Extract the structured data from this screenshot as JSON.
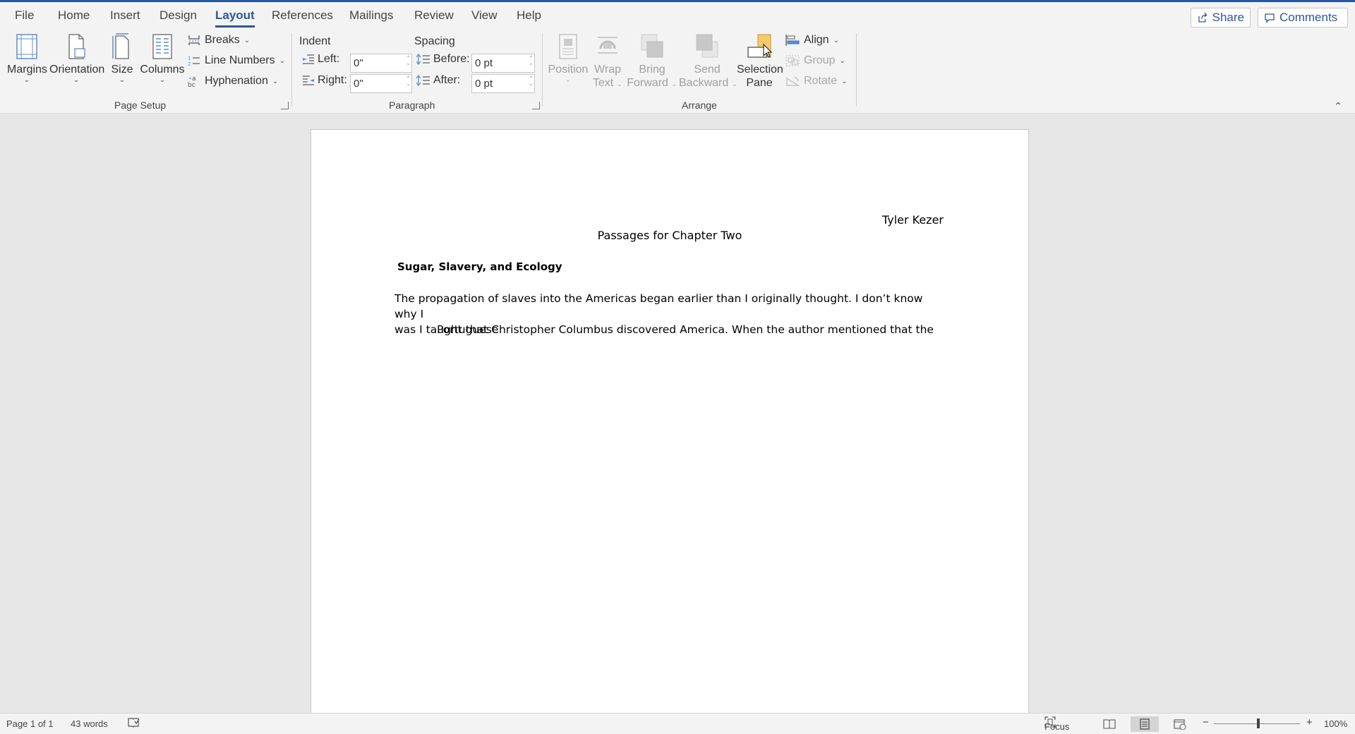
{
  "menu": {
    "tabs": [
      "File",
      "Home",
      "Insert",
      "Design",
      "Layout",
      "References",
      "Mailings",
      "Review",
      "View",
      "Help"
    ],
    "active_tab": "Layout",
    "share_label": "Share",
    "comments_label": "Comments"
  },
  "ribbon": {
    "page_setup": {
      "margins": "Margins",
      "orientation": "Orientation",
      "size": "Size",
      "columns": "Columns",
      "breaks": "Breaks",
      "line_numbers": "Line Numbers",
      "hyphenation": "Hyphenation",
      "group_label": "Page Setup"
    },
    "paragraph": {
      "indent_head": "Indent",
      "spacing_head": "Spacing",
      "left_label": "Left:",
      "right_label": "Right:",
      "before_label": "Before:",
      "after_label": "After:",
      "left_value": "0\"",
      "right_value": "0\"",
      "before_value": "0 pt",
      "after_value": "0 pt",
      "group_label": "Paragraph"
    },
    "arrange": {
      "position": "Position",
      "wrap_text_1": "Wrap",
      "wrap_text_2": "Text",
      "bring_forward_1": "Bring",
      "bring_forward_2": "Forward",
      "send_backward_1": "Send",
      "send_backward_2": "Backward",
      "selection_pane_1": "Selection",
      "selection_pane_2": "Pane",
      "align": "Align",
      "group": "Group",
      "rotate": "Rotate",
      "group_label": "Arrange"
    }
  },
  "document": {
    "author": "Tyler Kezer",
    "title": "Passages for Chapter Two",
    "heading": "Sugar, Slavery, and Ecology",
    "body_lines": [
      "The propagation of slaves into the Americas began earlier than I originally thought. I don’t know why I",
      "was I taught that Christopher Columbus discovered America. When the author mentioned that the"
    ],
    "body_continuation": "Portuguese"
  },
  "status": {
    "page": "Page 1 of 1",
    "words": "43 words",
    "focus": "Focus",
    "zoom": "100%",
    "zoom_minus": "−",
    "zoom_plus": "+"
  },
  "colors": {
    "accent": "#2b579a",
    "ribbon_bg": "#f3f3f3",
    "canvas_bg": "#e6e6e6"
  }
}
